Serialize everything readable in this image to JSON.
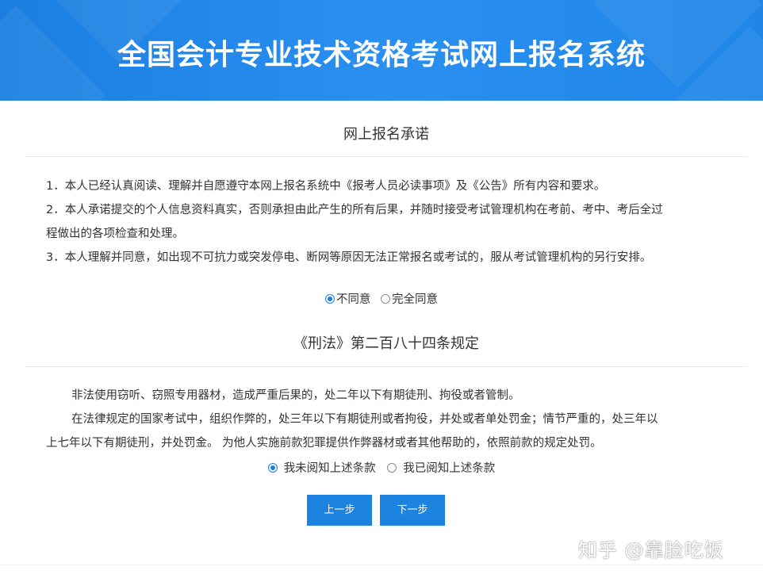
{
  "header": {
    "title": "全国会计专业技术资格考试网上报名系统"
  },
  "commitment": {
    "title": "网上报名承诺",
    "lines": [
      "1．本人已经认真阅读、理解并自愿遵守本网上报名系统中《报考人员必读事项》及《公告》所有内容和要求。",
      "2．本人承诺提交的个人信息资料真实，否则承担由此产生的所有后果，并随时接受考试管理机构在考前、考中、考后全过",
      "程做出的各项检查和处理。",
      "3．本人理解并同意，如出现不可抗力或突发停电、断网等原因无法正常报名或考试的，服从考试管理机构的另行安排。"
    ],
    "options": [
      {
        "label": "不同意",
        "checked": true
      },
      {
        "label": "完全同意",
        "checked": false
      }
    ]
  },
  "law": {
    "title": "《刑法》第二百八十四条规定",
    "lines": [
      "非法使用窃听、窃照专用器材，造成严重后果的，处二年以下有期徒刑、拘役或者管制。",
      "在法律规定的国家考试中，组织作弊的，处三年以下有期徒刑或者拘役，并处或者单处罚金；情节严重的，处三年以",
      "上七年以下有期徒刑，并处罚金。 为他人实施前款犯罪提供作弊器材或者其他帮助的，依照前款的规定处罚。"
    ],
    "options": [
      {
        "label": "我未阅知上述条款",
        "checked": true
      },
      {
        "label": "我已阅知上述条款",
        "checked": false
      }
    ]
  },
  "buttons": {
    "prev": "上一步",
    "next": "下一步"
  },
  "watermark": "知乎 @靠脸吃饭"
}
